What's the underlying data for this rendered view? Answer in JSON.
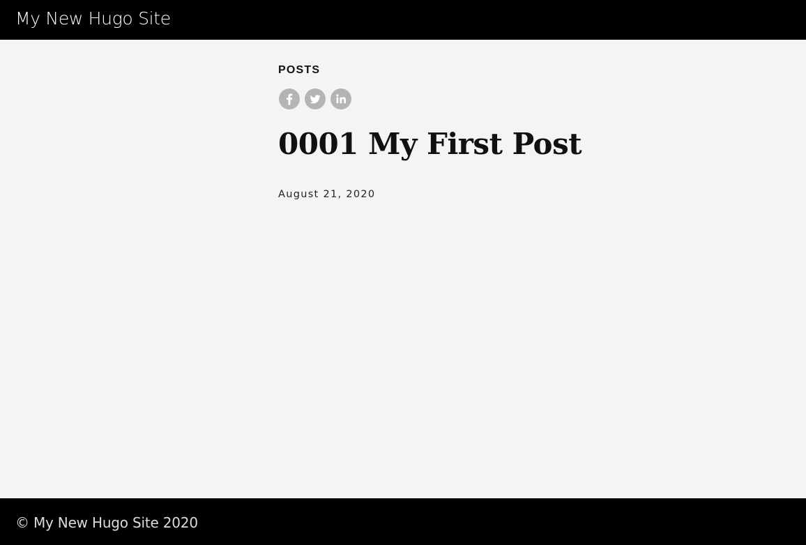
{
  "header": {
    "site_title": "My New Hugo Site"
  },
  "post": {
    "section": "POSTS",
    "title": "0001 My First Post",
    "date": "August 21, 2020",
    "share_icons": [
      "facebook-icon",
      "twitter-icon",
      "linkedin-icon"
    ]
  },
  "footer": {
    "copyright": "© My New Hugo Site 2020"
  },
  "colors": {
    "header_bg": "#000000",
    "page_bg": "#f4f4f4",
    "share_icon_bg": "#b4b4b4"
  }
}
